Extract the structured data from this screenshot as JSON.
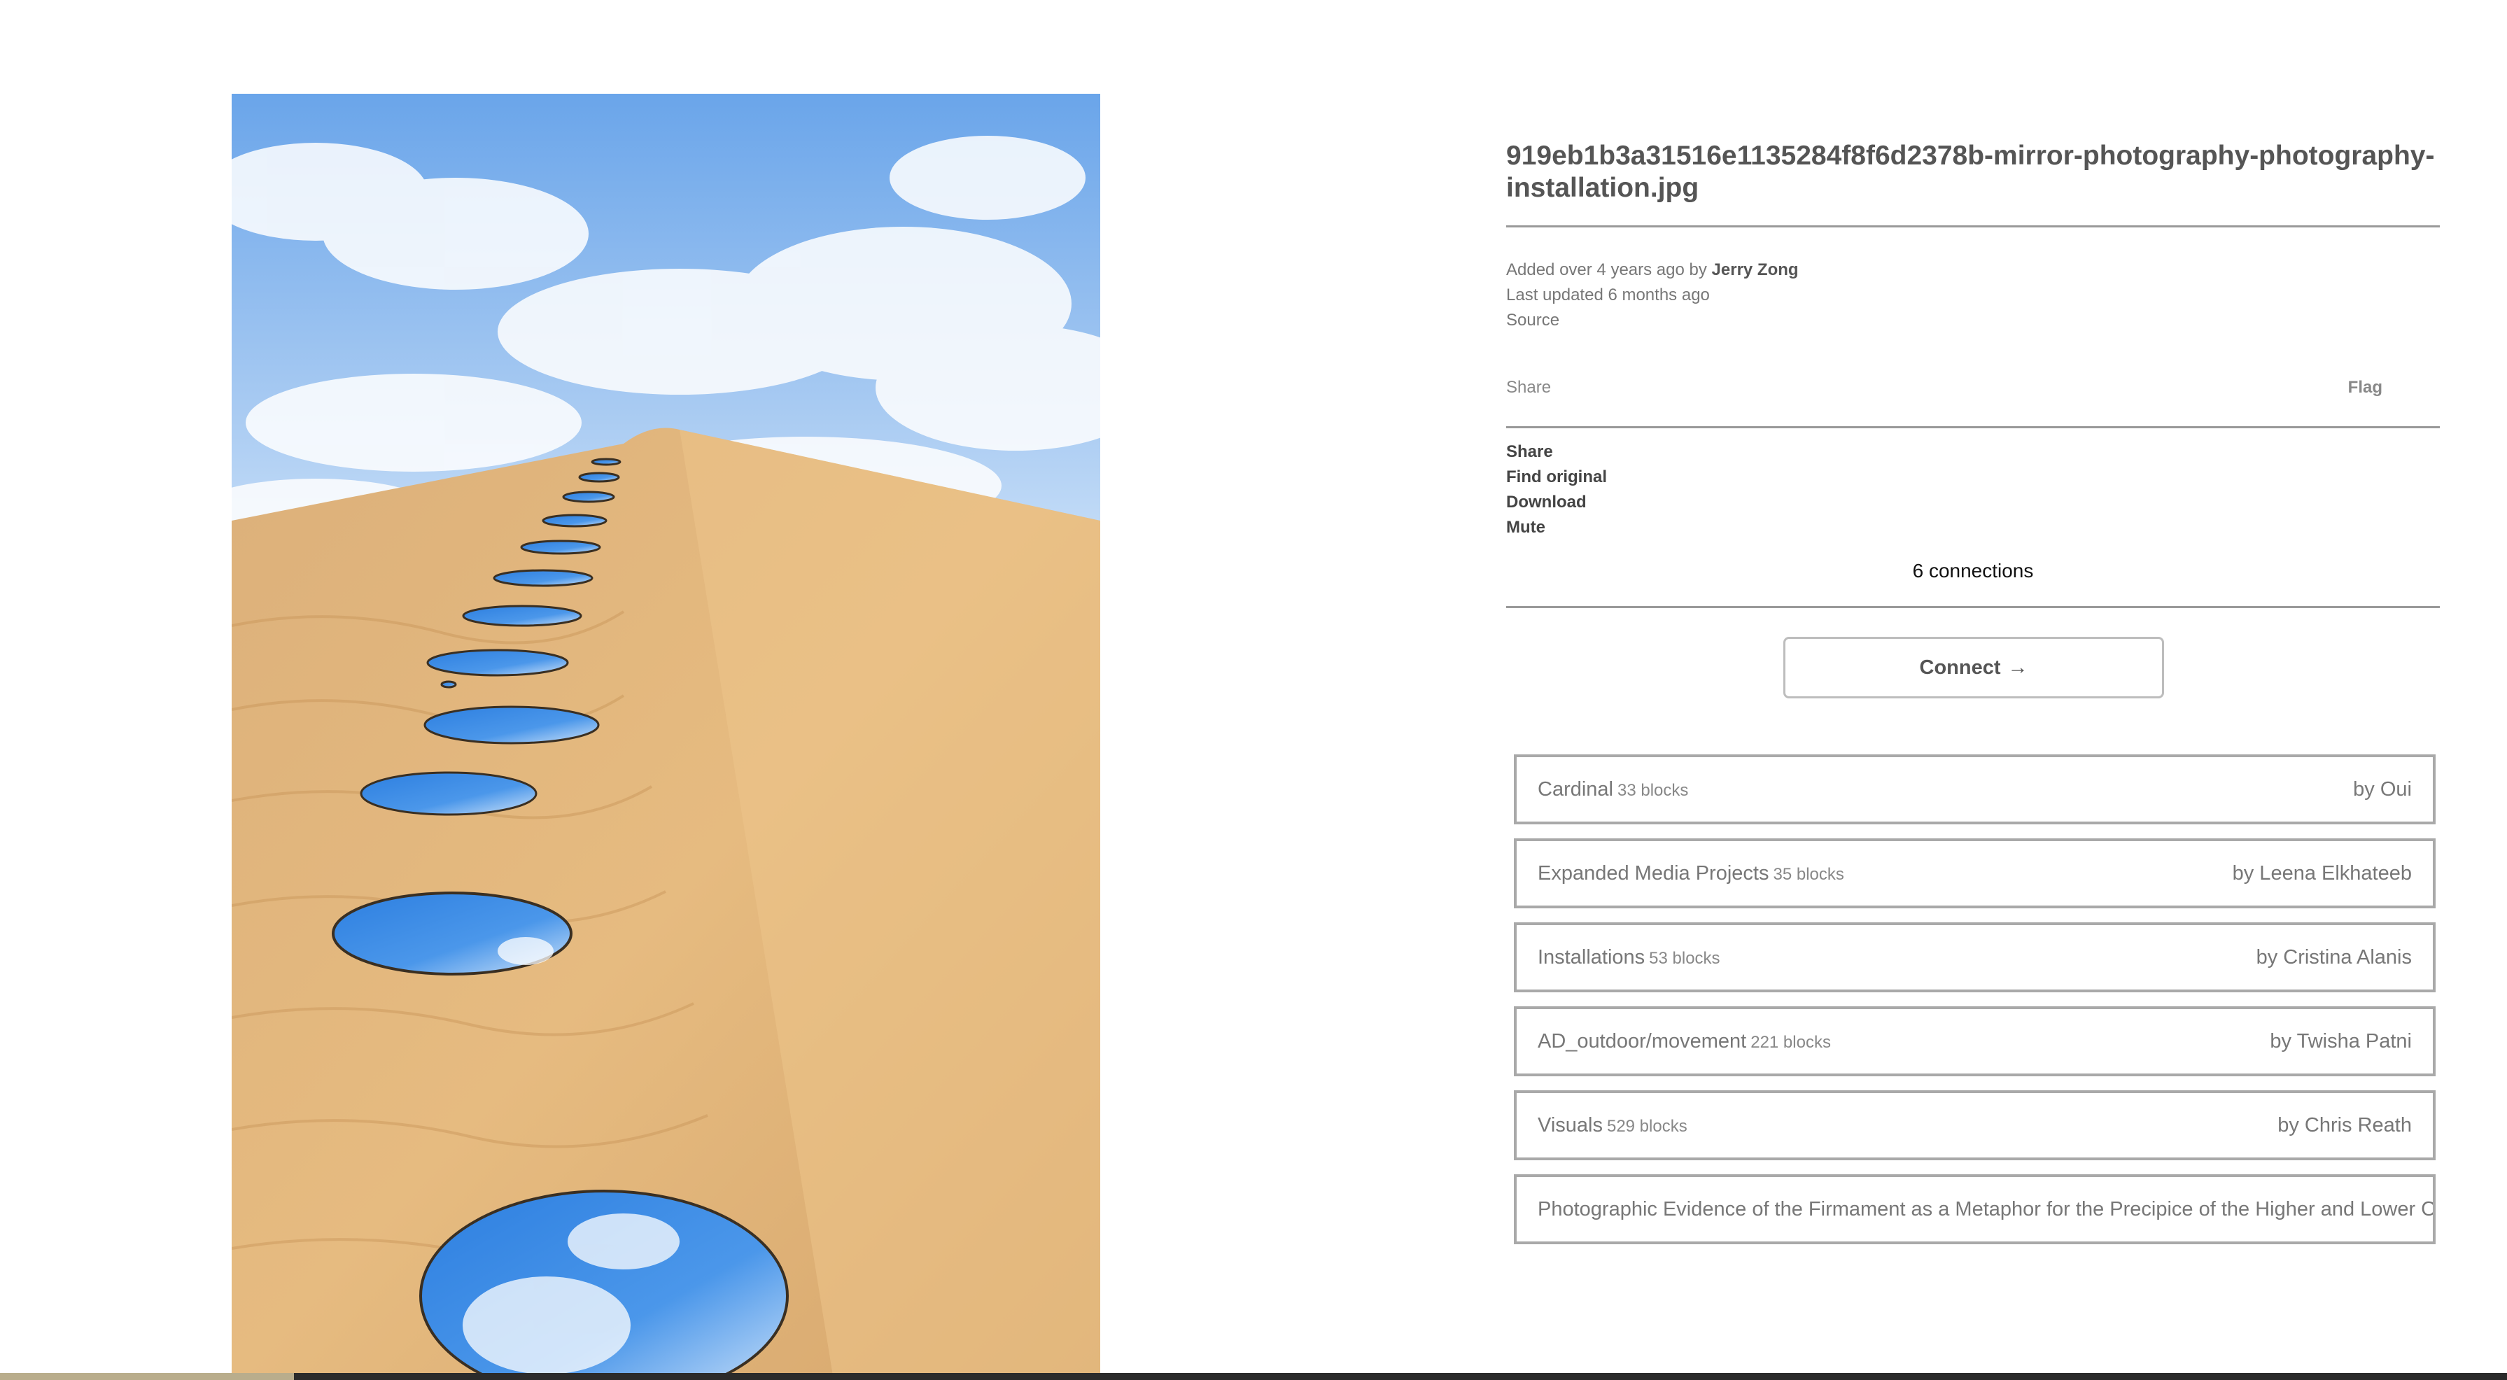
{
  "block": {
    "title": "919eb1b3a31516e1135284f8f6d2378b-mirror-photography-photography-installation.jpg",
    "image_alt": "Round mirrors arranged in a line up a sand dune reflecting a blue sky with clouds"
  },
  "info": {
    "added_prefix": "Added over 4 years ago by",
    "author": "Jerry Zong",
    "updated": "Last updated 6 months ago",
    "source": "Source"
  },
  "share_row": {
    "share": "Share",
    "flag": "Flag"
  },
  "actions": {
    "share": "Share",
    "find_original": "Find original",
    "download": "Download",
    "mute": "Mute"
  },
  "connections": {
    "label": "6 connections"
  },
  "connect_button": {
    "label": "Connect",
    "arrow": "→"
  },
  "channels": [
    {
      "name": "Cardinal",
      "count": "33 blocks",
      "owner": "by Oui"
    },
    {
      "name": "Expanded Media Projects",
      "count": "35 blocks",
      "owner": "by Leena Elkhateeb"
    },
    {
      "name": "Installations",
      "count": "53 blocks",
      "owner": "by Cristina Alanis"
    },
    {
      "name": "AD_outdoor/movement",
      "count": "221 blocks",
      "owner": "by Twisha Patni"
    },
    {
      "name": "Visuals",
      "count": "529 blocks",
      "owner": "by Chris Reath"
    },
    {
      "name": "Photographic Evidence of the Firmament as a Metaphor for the Precipice of the Higher and Lower Cons",
      "count": "",
      "owner": ""
    }
  ],
  "colors": {
    "sky": "#7fb2ee",
    "sand": "#e1b67c",
    "mirror": "#3f8de3",
    "border": "#a9a9a9"
  }
}
